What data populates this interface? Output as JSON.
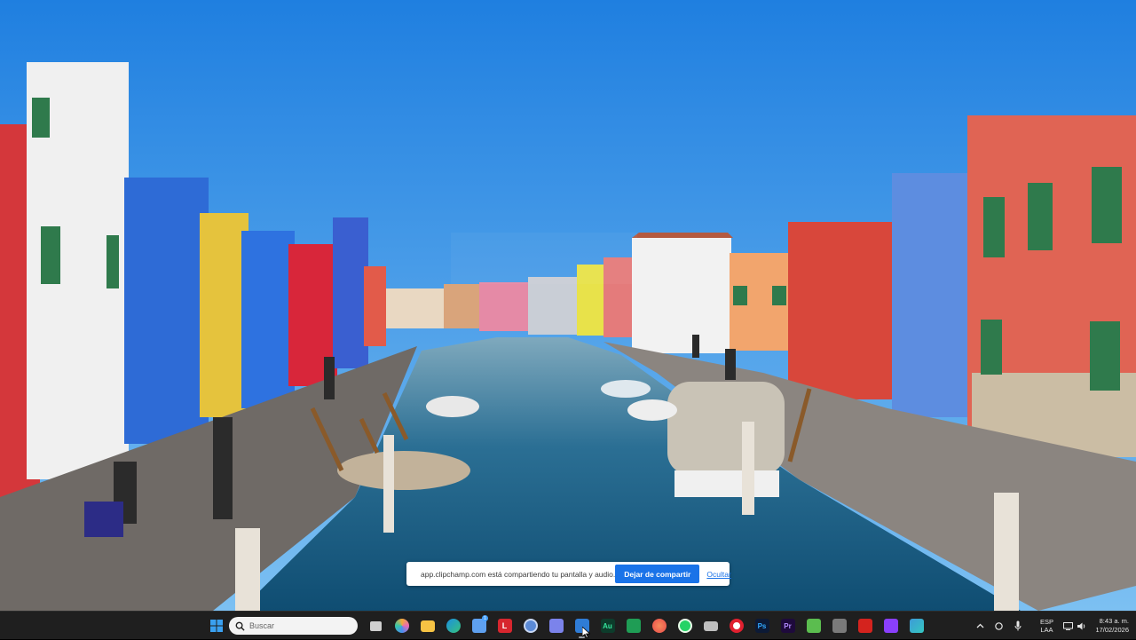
{
  "wallpaper": {
    "description_icon": "landscape-photo"
  },
  "share_notification": {
    "message": "app.clipchamp.com está compartiendo tu pantalla y audio.",
    "stop_label": "Dejar de compartir",
    "hide_label": "Ocultar",
    "accent": "#1a73e8"
  },
  "taskbar": {
    "search_placeholder": "Buscar",
    "apps": [
      {
        "name": "start-icon",
        "color": "#3aa0f0"
      },
      {
        "name": "task-view-icon",
        "color": "#cfcfcf"
      },
      {
        "name": "copilot-icon",
        "color": "#e86ab5"
      },
      {
        "name": "file-explorer-icon",
        "color": "#f6c344"
      },
      {
        "name": "edge-icon",
        "color": "#2fb5a3"
      },
      {
        "name": "store-icon",
        "color": "#5ea0ef"
      },
      {
        "name": "l-app-icon",
        "color": "#d7262e",
        "label": "L"
      },
      {
        "name": "globe-app-icon",
        "color": "#5b8ad6"
      },
      {
        "name": "teams-icon",
        "color": "#7b83eb"
      },
      {
        "name": "outlook-icon",
        "color": "#2f7cd6"
      },
      {
        "name": "audition-icon",
        "color": "#0d3c2b",
        "label": "Au"
      },
      {
        "name": "excel-icon",
        "color": "#1f9d55"
      },
      {
        "name": "red-circle-app-icon",
        "color": "#e84a4a"
      },
      {
        "name": "whatsapp-icon",
        "color": "#25d366"
      },
      {
        "name": "printer-icon",
        "color": "#bfbfbf"
      },
      {
        "name": "opera-icon",
        "color": "#e0202f"
      },
      {
        "name": "photoshop-icon",
        "color": "#0c1a36",
        "label": "Ps"
      },
      {
        "name": "premiere-icon",
        "color": "#1e0a3c",
        "label": "Pr"
      },
      {
        "name": "green-app-icon",
        "color": "#5bbd4f"
      },
      {
        "name": "calculator-icon",
        "color": "#7a7a7a"
      },
      {
        "name": "acrobat-icon",
        "color": "#d4231e"
      },
      {
        "name": "purple-app-icon",
        "color": "#8a3ffc"
      },
      {
        "name": "clipchamp-icon",
        "color": "#3d9ad8"
      }
    ],
    "store_badge": "1",
    "tray": {
      "language_line1": "ESP",
      "language_line2": "LAA",
      "time": "8:43 a. m.",
      "date": "17/02/2026"
    }
  }
}
